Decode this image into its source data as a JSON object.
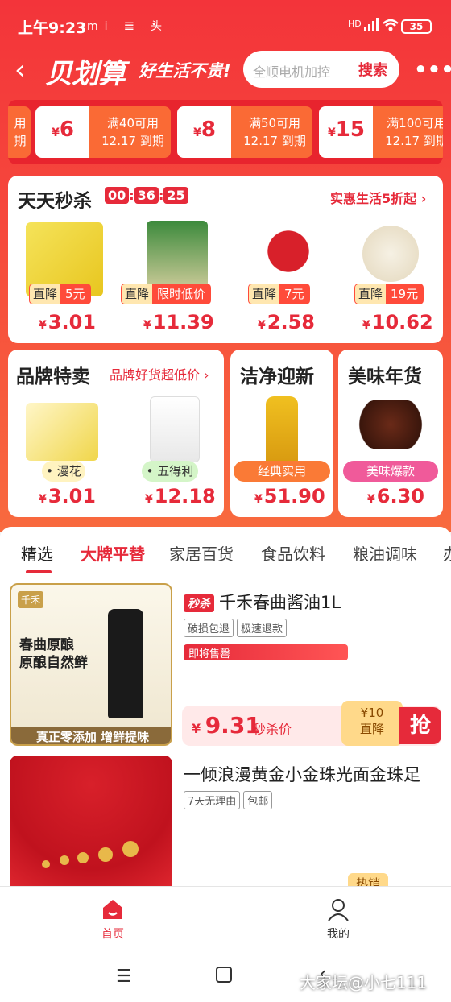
{
  "status_bar": {
    "time": "上午9:23",
    "app_icons": "mi 𝌆 头",
    "dot": "·",
    "signal": "HD",
    "battery": "35"
  },
  "header": {
    "logo": "贝划算",
    "slogan": "好生活不贵!",
    "search_placeholder": "全顺电机加控",
    "search_button": "搜索"
  },
  "coupons": [
    {
      "amount": "",
      "condition": "用",
      "expire": "期"
    },
    {
      "amount": "6",
      "condition": "满40可用",
      "expire": "12.17 到期"
    },
    {
      "amount": "8",
      "condition": "满50可用",
      "expire": "12.17 到期"
    },
    {
      "amount": "15",
      "condition": "满100可用",
      "expire": "12.17 到期"
    }
  ],
  "flash_sale": {
    "title": "天天秒杀",
    "timer": [
      "00",
      "36",
      "25"
    ],
    "link": "实惠生活5折起",
    "products": [
      {
        "tag_left": "直降",
        "tag_right": "5元",
        "price": "3.01",
        "image": "tissue-pack"
      },
      {
        "tag_left": "直降",
        "tag_right": "限时低价",
        "price": "11.39",
        "image": "rice-bag"
      },
      {
        "tag_left": "直降",
        "tag_right": "7元",
        "price": "2.58",
        "image": "spring-couplets"
      },
      {
        "tag_left": "直降",
        "tag_right": "19元",
        "price": "10.62",
        "image": "melon-seeds"
      }
    ]
  },
  "brand_sale": {
    "title": "品牌特卖",
    "link": "品牌好货超低价",
    "products": [
      {
        "brand": "漫花",
        "price": "3.01"
      },
      {
        "brand": "五得利",
        "price": "12.18"
      }
    ]
  },
  "clean_new": {
    "title": "洁净迎新",
    "pill": "经典实用",
    "price": "51.90"
  },
  "tasty_goods": {
    "title": "美味年货",
    "pill": "美味爆款",
    "price": "6.30"
  },
  "tabs": [
    "精选",
    "大牌平替",
    "家居百货",
    "食品饮料",
    "粮油调味",
    "办"
  ],
  "feed": [
    {
      "badge": "秒杀",
      "title": "千禾春曲酱油1L",
      "chips": [
        "破损包退",
        "极速退款"
      ],
      "stock_label": "即将售罄",
      "price": "9.31",
      "price_label": "秒杀价",
      "drop_amount": "¥10",
      "drop_label": "直降",
      "grab": "抢",
      "image_brand": "千禾",
      "image_text1": "春曲原酿",
      "image_text2": "原酿自然鲜",
      "image_footer": "真正零添加 增鲜提味"
    },
    {
      "title": "一倾浪漫黄金小金珠光面金珠足",
      "chips": [
        "7天无理由",
        "包邮"
      ],
      "hot_label": "热销"
    }
  ],
  "bottom_nav": [
    {
      "label": "首页",
      "icon": "home-icon"
    },
    {
      "label": "我的",
      "icon": "user-icon"
    }
  ],
  "watermark": "大家坛@小七111",
  "colors": {
    "primary": "#e62a3a",
    "hero": "#f3343a"
  }
}
